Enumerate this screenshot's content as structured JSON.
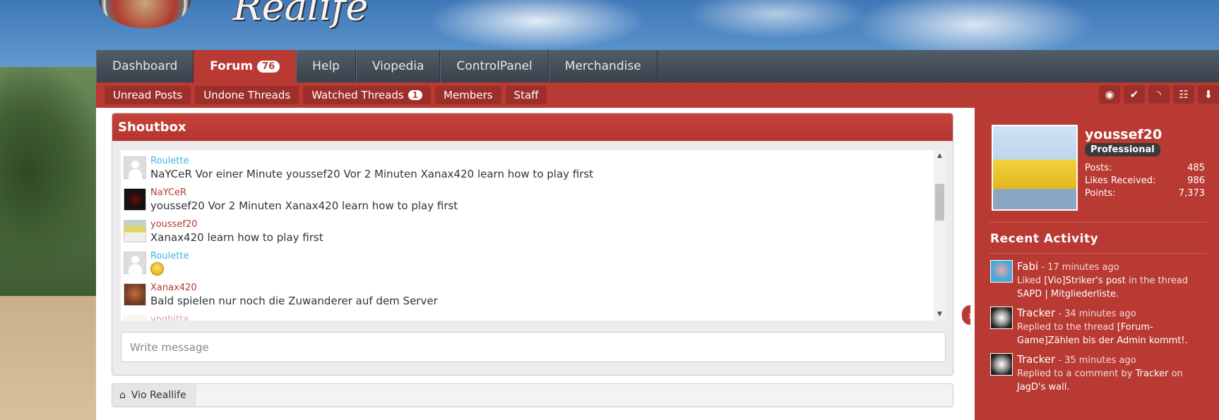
{
  "site": {
    "logo_text": "Realife"
  },
  "nav": {
    "tabs": [
      {
        "label": "Dashboard"
      },
      {
        "label": "Forum",
        "badge": "76"
      },
      {
        "label": "Help"
      },
      {
        "label": "Viopedia"
      },
      {
        "label": "ControlPanel"
      },
      {
        "label": "Merchandise"
      }
    ]
  },
  "subnav": {
    "items": [
      {
        "label": "Unread Posts"
      },
      {
        "label": "Undone Threads"
      },
      {
        "label": "Watched Threads",
        "badge": "1"
      },
      {
        "label": "Members"
      },
      {
        "label": "Staff"
      }
    ],
    "icons": [
      "eye-icon",
      "check-icon",
      "rss-icon",
      "sitemap-icon",
      "download-icon"
    ]
  },
  "shoutbox": {
    "title": "Shoutbox",
    "messages": [
      {
        "user": "Roulette",
        "text": "NaYCeR Vor einer Minute youssef20 Vor 2 Minuten Xanax420 learn how to play first"
      },
      {
        "user": "NaYCeR",
        "text": "youssef20 Vor 2 Minuten Xanax420 learn how to play first"
      },
      {
        "user": "youssef20",
        "text": "Xanax420 learn how to play first"
      },
      {
        "user": "Roulette",
        "text": ""
      },
      {
        "user": "Xanax420",
        "text": "Bald spielen nur noch die Zuwanderer auf dem Server"
      },
      {
        "user": "ynghitta",
        "text": ""
      }
    ],
    "input_placeholder": "Write message"
  },
  "breadcrumb": {
    "label": "Vio Reallife"
  },
  "profile": {
    "name": "youssef20",
    "rank": "Professional",
    "stats": [
      {
        "label": "Posts:",
        "value": "485"
      },
      {
        "label": "Likes Received:",
        "value": "986"
      },
      {
        "label": "Points:",
        "value": "7,373"
      }
    ]
  },
  "recent_activity": {
    "title": "Recent Activity",
    "items": [
      {
        "user": "Fabi",
        "time": "- 17 minutes ago",
        "desc_a": "Liked ",
        "link_a": "[Vio]Striker's post",
        "desc_b": " in the thread ",
        "link_b": "SAPD | Mitgliederliste."
      },
      {
        "user": "Tracker",
        "time": "- 34 minutes ago",
        "desc_a": "Replied to the thread ",
        "link_a": "[Forum-Game]Zählen bis der Admin kommt!.",
        "desc_b": "",
        "link_b": ""
      },
      {
        "user": "Tracker",
        "time": "- 35 minutes ago",
        "desc_a": "Replied to a comment by ",
        "link_a": "Tracker",
        "desc_b": " on ",
        "link_b": "JagD's wall."
      }
    ]
  }
}
